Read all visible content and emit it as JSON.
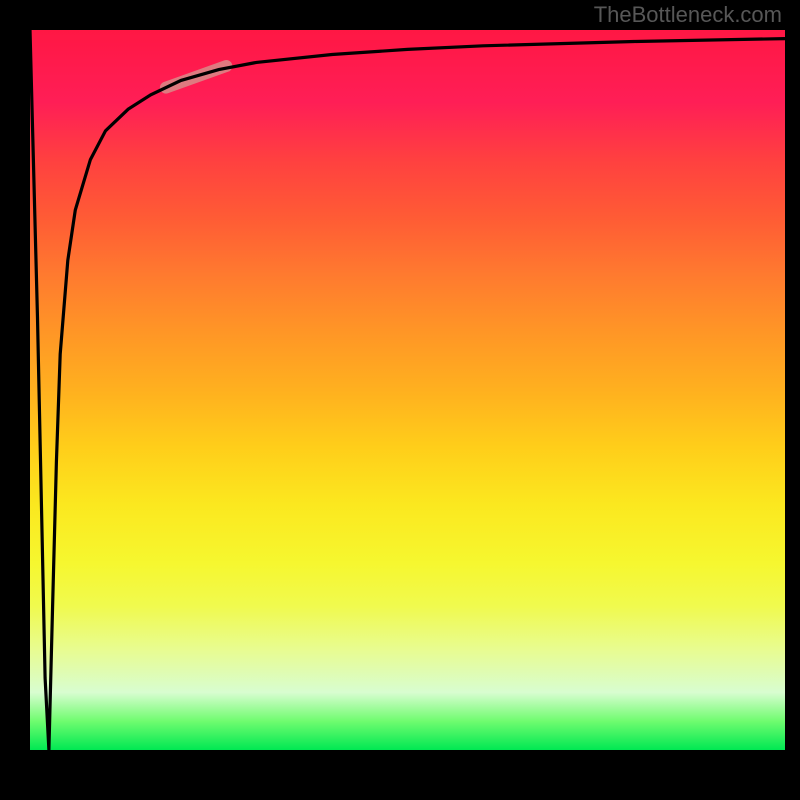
{
  "watermark": "TheBottleneck.com",
  "chart_data": {
    "type": "line",
    "title": "",
    "xlabel": "",
    "ylabel": "",
    "xlim": [
      0,
      100
    ],
    "ylim": [
      0,
      100
    ],
    "series": [
      {
        "name": "curve",
        "color": "#000000",
        "x": [
          0,
          1,
          2,
          2.5,
          3,
          3.5,
          4,
          5,
          6,
          8,
          10,
          13,
          16,
          20,
          25,
          30,
          40,
          50,
          60,
          80,
          100
        ],
        "y": [
          100,
          60,
          10,
          0,
          20,
          40,
          55,
          68,
          75,
          82,
          86,
          89,
          91,
          93,
          94.5,
          95.5,
          96.6,
          97.3,
          97.8,
          98.4,
          98.8
        ]
      }
    ],
    "highlight_segment": {
      "color": "#d88b88",
      "x_range": [
        18,
        26
      ],
      "y_range": [
        92,
        95
      ]
    },
    "gradient_stops": [
      {
        "pos": 0.0,
        "color": "#ff1744"
      },
      {
        "pos": 0.34,
        "color": "#ff7a2f"
      },
      {
        "pos": 0.66,
        "color": "#fbe81f"
      },
      {
        "pos": 0.92,
        "color": "#d8fdd0"
      },
      {
        "pos": 1.0,
        "color": "#00e853"
      }
    ]
  }
}
